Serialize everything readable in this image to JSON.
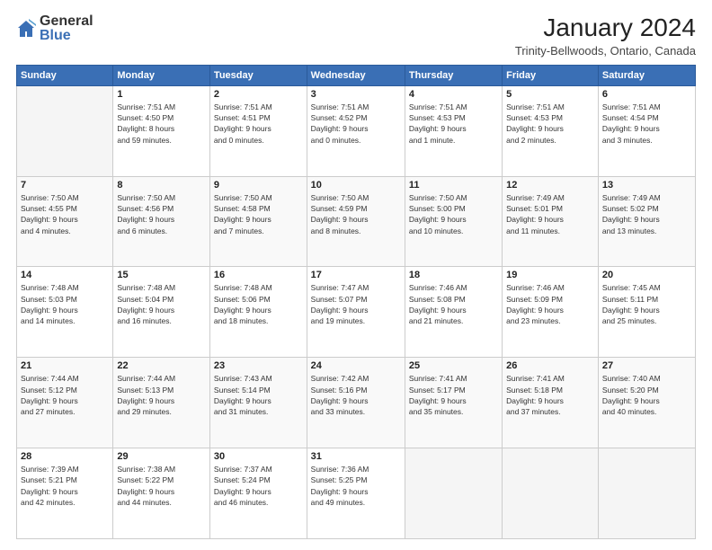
{
  "logo": {
    "general": "General",
    "blue": "Blue"
  },
  "header": {
    "title": "January 2024",
    "subtitle": "Trinity-Bellwoods, Ontario, Canada"
  },
  "weekdays": [
    "Sunday",
    "Monday",
    "Tuesday",
    "Wednesday",
    "Thursday",
    "Friday",
    "Saturday"
  ],
  "weeks": [
    [
      {
        "day": "",
        "info": ""
      },
      {
        "day": "1",
        "info": "Sunrise: 7:51 AM\nSunset: 4:50 PM\nDaylight: 8 hours\nand 59 minutes."
      },
      {
        "day": "2",
        "info": "Sunrise: 7:51 AM\nSunset: 4:51 PM\nDaylight: 9 hours\nand 0 minutes."
      },
      {
        "day": "3",
        "info": "Sunrise: 7:51 AM\nSunset: 4:52 PM\nDaylight: 9 hours\nand 0 minutes."
      },
      {
        "day": "4",
        "info": "Sunrise: 7:51 AM\nSunset: 4:53 PM\nDaylight: 9 hours\nand 1 minute."
      },
      {
        "day": "5",
        "info": "Sunrise: 7:51 AM\nSunset: 4:53 PM\nDaylight: 9 hours\nand 2 minutes."
      },
      {
        "day": "6",
        "info": "Sunrise: 7:51 AM\nSunset: 4:54 PM\nDaylight: 9 hours\nand 3 minutes."
      }
    ],
    [
      {
        "day": "7",
        "info": "Sunrise: 7:50 AM\nSunset: 4:55 PM\nDaylight: 9 hours\nand 4 minutes."
      },
      {
        "day": "8",
        "info": "Sunrise: 7:50 AM\nSunset: 4:56 PM\nDaylight: 9 hours\nand 6 minutes."
      },
      {
        "day": "9",
        "info": "Sunrise: 7:50 AM\nSunset: 4:58 PM\nDaylight: 9 hours\nand 7 minutes."
      },
      {
        "day": "10",
        "info": "Sunrise: 7:50 AM\nSunset: 4:59 PM\nDaylight: 9 hours\nand 8 minutes."
      },
      {
        "day": "11",
        "info": "Sunrise: 7:50 AM\nSunset: 5:00 PM\nDaylight: 9 hours\nand 10 minutes."
      },
      {
        "day": "12",
        "info": "Sunrise: 7:49 AM\nSunset: 5:01 PM\nDaylight: 9 hours\nand 11 minutes."
      },
      {
        "day": "13",
        "info": "Sunrise: 7:49 AM\nSunset: 5:02 PM\nDaylight: 9 hours\nand 13 minutes."
      }
    ],
    [
      {
        "day": "14",
        "info": "Sunrise: 7:48 AM\nSunset: 5:03 PM\nDaylight: 9 hours\nand 14 minutes."
      },
      {
        "day": "15",
        "info": "Sunrise: 7:48 AM\nSunset: 5:04 PM\nDaylight: 9 hours\nand 16 minutes."
      },
      {
        "day": "16",
        "info": "Sunrise: 7:48 AM\nSunset: 5:06 PM\nDaylight: 9 hours\nand 18 minutes."
      },
      {
        "day": "17",
        "info": "Sunrise: 7:47 AM\nSunset: 5:07 PM\nDaylight: 9 hours\nand 19 minutes."
      },
      {
        "day": "18",
        "info": "Sunrise: 7:46 AM\nSunset: 5:08 PM\nDaylight: 9 hours\nand 21 minutes."
      },
      {
        "day": "19",
        "info": "Sunrise: 7:46 AM\nSunset: 5:09 PM\nDaylight: 9 hours\nand 23 minutes."
      },
      {
        "day": "20",
        "info": "Sunrise: 7:45 AM\nSunset: 5:11 PM\nDaylight: 9 hours\nand 25 minutes."
      }
    ],
    [
      {
        "day": "21",
        "info": "Sunrise: 7:44 AM\nSunset: 5:12 PM\nDaylight: 9 hours\nand 27 minutes."
      },
      {
        "day": "22",
        "info": "Sunrise: 7:44 AM\nSunset: 5:13 PM\nDaylight: 9 hours\nand 29 minutes."
      },
      {
        "day": "23",
        "info": "Sunrise: 7:43 AM\nSunset: 5:14 PM\nDaylight: 9 hours\nand 31 minutes."
      },
      {
        "day": "24",
        "info": "Sunrise: 7:42 AM\nSunset: 5:16 PM\nDaylight: 9 hours\nand 33 minutes."
      },
      {
        "day": "25",
        "info": "Sunrise: 7:41 AM\nSunset: 5:17 PM\nDaylight: 9 hours\nand 35 minutes."
      },
      {
        "day": "26",
        "info": "Sunrise: 7:41 AM\nSunset: 5:18 PM\nDaylight: 9 hours\nand 37 minutes."
      },
      {
        "day": "27",
        "info": "Sunrise: 7:40 AM\nSunset: 5:20 PM\nDaylight: 9 hours\nand 40 minutes."
      }
    ],
    [
      {
        "day": "28",
        "info": "Sunrise: 7:39 AM\nSunset: 5:21 PM\nDaylight: 9 hours\nand 42 minutes."
      },
      {
        "day": "29",
        "info": "Sunrise: 7:38 AM\nSunset: 5:22 PM\nDaylight: 9 hours\nand 44 minutes."
      },
      {
        "day": "30",
        "info": "Sunrise: 7:37 AM\nSunset: 5:24 PM\nDaylight: 9 hours\nand 46 minutes."
      },
      {
        "day": "31",
        "info": "Sunrise: 7:36 AM\nSunset: 5:25 PM\nDaylight: 9 hours\nand 49 minutes."
      },
      {
        "day": "",
        "info": ""
      },
      {
        "day": "",
        "info": ""
      },
      {
        "day": "",
        "info": ""
      }
    ]
  ]
}
